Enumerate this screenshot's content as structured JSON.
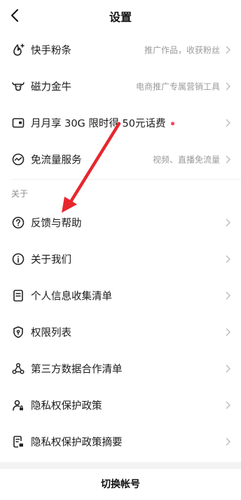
{
  "header": {
    "title": "设置"
  },
  "rows_top": [
    {
      "label": "快手粉条",
      "hint": "推广作品，收获粉丝",
      "icon": "fan-boost-icon"
    },
    {
      "label": "磁力金牛",
      "hint": "电商推广专属营销工具",
      "icon": "bull-icon"
    },
    {
      "label": "月月享 30G 限时得 50元话费",
      "hint": "",
      "icon": "sim-card-icon",
      "dot_color": "#ff3b5c"
    },
    {
      "label": "免流量服务",
      "hint": "视频、直播免流量",
      "icon": "free-data-icon"
    }
  ],
  "section_about": "关于",
  "rows_about": [
    {
      "label": "反馈与帮助",
      "icon": "help-circle-icon"
    },
    {
      "label": "关于我们",
      "icon": "info-circle-icon"
    },
    {
      "label": "个人信息收集清单",
      "icon": "document-list-icon"
    },
    {
      "label": "权限列表",
      "icon": "shield-icon"
    },
    {
      "label": "第三方数据合作清单",
      "icon": "network-icon"
    },
    {
      "label": "隐私权保护政策",
      "icon": "user-privacy-icon"
    },
    {
      "label": "隐私权保护政策摘要",
      "icon": "document-summary-icon"
    }
  ],
  "footer": {
    "switch_account": "切换帐号"
  },
  "colors": {
    "annotation_arrow": "#e8262e",
    "dot": "#ff3b5c"
  }
}
